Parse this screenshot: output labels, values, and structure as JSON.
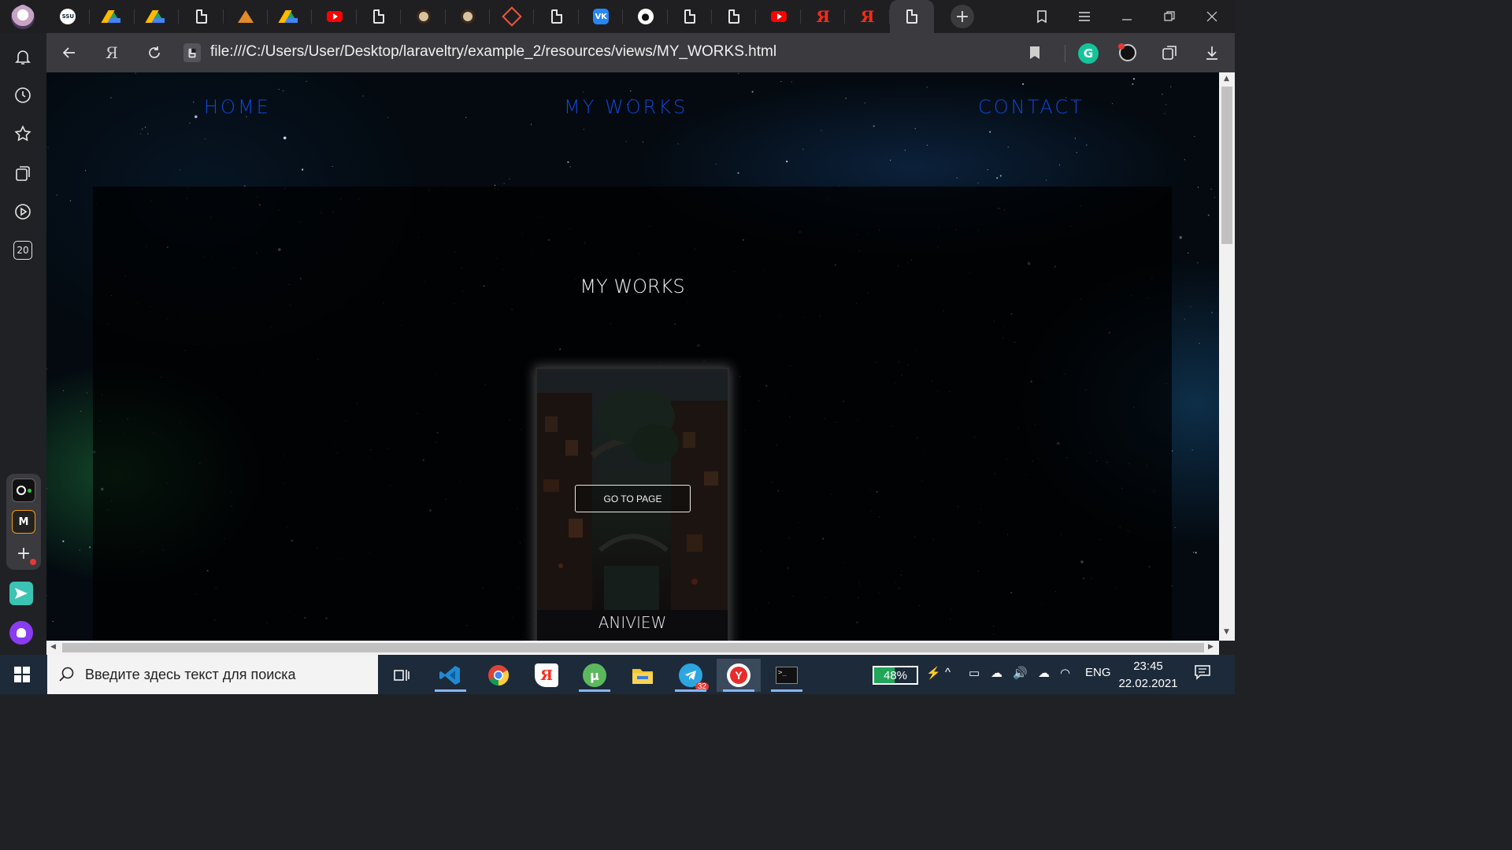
{
  "browser": {
    "tabs": [
      {
        "icon": "avatar-icon"
      },
      {
        "icon": "ssu-icon",
        "text": "SSU"
      },
      {
        "icon": "google-drive-icon"
      },
      {
        "icon": "google-drive-icon"
      },
      {
        "icon": "page-icon"
      },
      {
        "icon": "triangle-logo-icon"
      },
      {
        "icon": "google-drive-icon"
      },
      {
        "icon": "youtube-icon"
      },
      {
        "icon": "page-icon"
      },
      {
        "icon": "dog-icon"
      },
      {
        "icon": "dog-icon"
      },
      {
        "icon": "laravel-icon"
      },
      {
        "icon": "page-icon"
      },
      {
        "icon": "vk-icon",
        "text": "VK"
      },
      {
        "icon": "github-icon"
      },
      {
        "icon": "page-icon"
      },
      {
        "icon": "page-icon"
      },
      {
        "icon": "youtube-icon"
      },
      {
        "icon": "yandex-icon",
        "text": "Я"
      },
      {
        "icon": "yandex-icon",
        "text": "Я"
      },
      {
        "icon": "page-icon",
        "active": true
      }
    ],
    "yandex_letter": "Я",
    "address_url": "file:///C:/Users/User/Desktop/laraveltry/example_2/resources/views/MY_WORKS.html",
    "sidebar_counter": "20",
    "grammarly_letter": "G"
  },
  "page": {
    "nav": {
      "home": "HOME",
      "works": "MY WORKS",
      "contact": "CONTACT"
    },
    "section_title": "MY WORKS",
    "card": {
      "button_label": "GO TO PAGE",
      "title": "ANIVIEW"
    },
    "colors": {
      "nav_link": "#1147d6",
      "background": "#040a10"
    }
  },
  "taskbar": {
    "search_placeholder": "Введите здесь текст для поиска",
    "telegram_badge": "32",
    "battery_percent": "48%",
    "battery_level": 0.48,
    "language": "ENG",
    "time": "23:45",
    "date": "22.02.2021"
  }
}
